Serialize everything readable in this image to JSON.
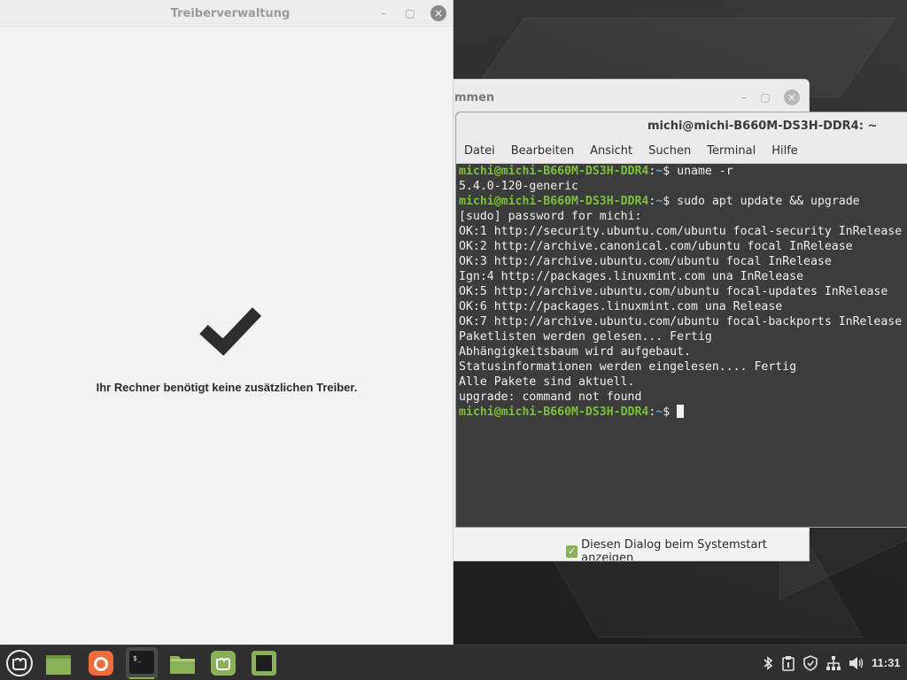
{
  "drivers_window": {
    "title": "Treiberverwaltung",
    "minimize": "–",
    "maximize": "▢",
    "close": "×",
    "message": "Ihr Rechner benötigt keine zusätzlichen Treiber."
  },
  "welcome_window": {
    "title_fragment": "mmen",
    "checkbox_label": "Diesen Dialog beim Systemstart anzeigen",
    "checkbox_checked": true,
    "minimize": "–",
    "maximize": "▢",
    "close": "×"
  },
  "terminal": {
    "title": "michi@michi-B660M-DS3H-DDR4: ~",
    "menu": [
      "Datei",
      "Bearbeiten",
      "Ansicht",
      "Suchen",
      "Terminal",
      "Hilfe"
    ],
    "prompt_user": "michi@michi-B660M-DS3H-DDR4",
    "prompt_sep": ":",
    "prompt_path": "~",
    "prompt_end": "$ ",
    "lines": [
      {
        "type": "cmd",
        "text": "uname -r"
      },
      {
        "type": "out",
        "text": "5.4.0-120-generic"
      },
      {
        "type": "cmd",
        "text": "sudo apt update && upgrade"
      },
      {
        "type": "out",
        "text": "[sudo] password for michi:"
      },
      {
        "type": "out",
        "text": "OK:1 http://security.ubuntu.com/ubuntu focal-security InRelease"
      },
      {
        "type": "out",
        "text": "OK:2 http://archive.canonical.com/ubuntu focal InRelease"
      },
      {
        "type": "out",
        "text": "OK:3 http://archive.ubuntu.com/ubuntu focal InRelease"
      },
      {
        "type": "out",
        "text": "Ign:4 http://packages.linuxmint.com una InRelease"
      },
      {
        "type": "out",
        "text": "OK:5 http://archive.ubuntu.com/ubuntu focal-updates InRelease"
      },
      {
        "type": "out",
        "text": "OK:6 http://packages.linuxmint.com una Release"
      },
      {
        "type": "out",
        "text": "OK:7 http://archive.ubuntu.com/ubuntu focal-backports InRelease"
      },
      {
        "type": "out",
        "text": "Paketlisten werden gelesen... Fertig"
      },
      {
        "type": "out",
        "text": "Abhängigkeitsbaum wird aufgebaut."
      },
      {
        "type": "out",
        "text": "Statusinformationen werden eingelesen.... Fertig"
      },
      {
        "type": "out",
        "text": "Alle Pakete sind aktuell."
      },
      {
        "type": "out",
        "text": "upgrade: command not found"
      },
      {
        "type": "cmd",
        "text": ""
      }
    ]
  },
  "taskbar": {
    "items": [
      {
        "name": "mint-menu-icon",
        "active": false
      },
      {
        "name": "show-desktop-icon",
        "active": false
      },
      {
        "name": "firefox-icon",
        "active": false
      },
      {
        "name": "terminal-icon",
        "active": true
      },
      {
        "name": "files-icon",
        "active": false
      },
      {
        "name": "mintwelcome-icon",
        "active": false
      },
      {
        "name": "driver-manager-icon",
        "active": false
      }
    ],
    "tray": [
      "bluetooth-icon",
      "clipboard-icon",
      "shield-icon",
      "network-icon",
      "volume-icon"
    ],
    "clock": "11:31"
  },
  "colors": {
    "prompt_green": "#78c13b",
    "prompt_blue": "#6a9fdb",
    "terminal_bg": "#3c3c3c",
    "mint_green": "#8bb158"
  }
}
